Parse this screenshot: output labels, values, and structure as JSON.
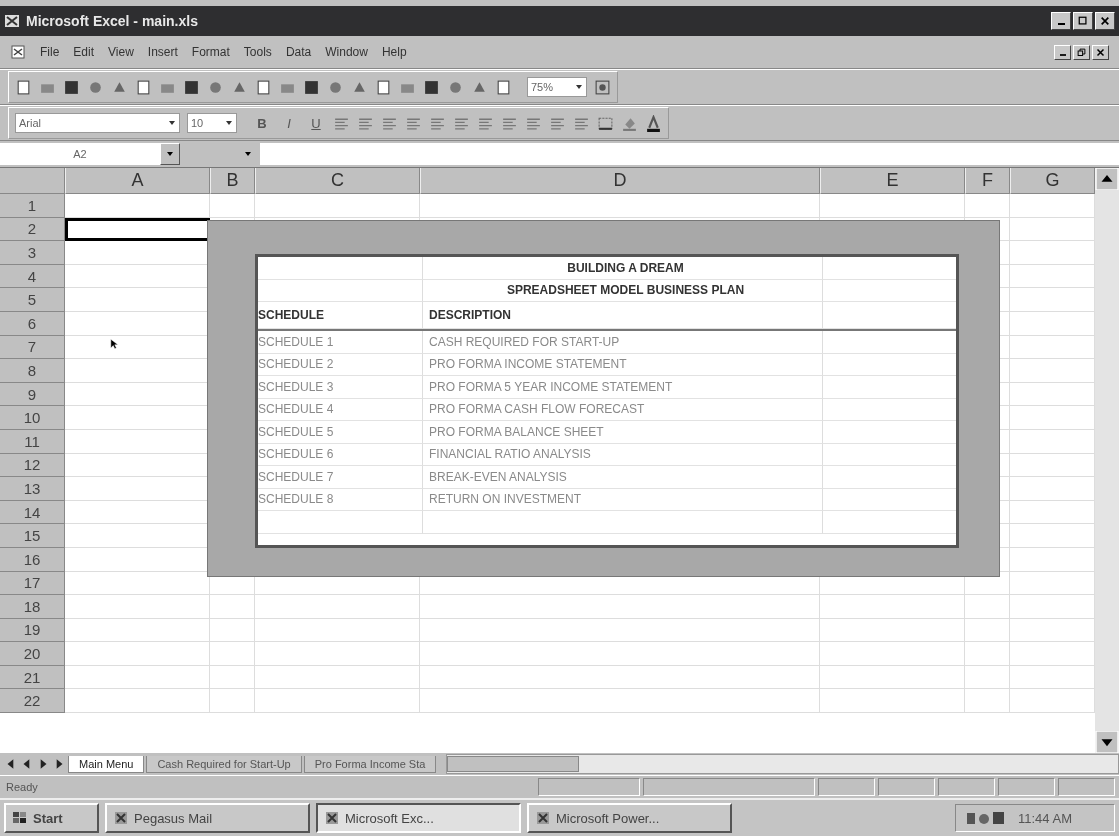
{
  "window": {
    "title": "Microsoft Excel - main.xls"
  },
  "menu": [
    "File",
    "Edit",
    "View",
    "Insert",
    "Format",
    "Tools",
    "Data",
    "Window",
    "Help"
  ],
  "toolbar": {
    "font": "Arial",
    "font_size": "10",
    "zoom": "75%",
    "format_buttons": [
      "B",
      "I",
      "U"
    ]
  },
  "formula_bar": {
    "name_box": "A2"
  },
  "sheet": {
    "columns": [
      "A",
      "B",
      "C",
      "D",
      "E",
      "F",
      "G"
    ],
    "rows": [
      {
        "label": "1",
        "selected": false
      },
      {
        "label": "2",
        "selected": true
      },
      {
        "label": "3",
        "selected": false
      },
      {
        "label": "4",
        "selected": false
      },
      {
        "label": "5",
        "selected": false
      },
      {
        "label": "6",
        "selected": false
      },
      {
        "label": "7",
        "selected": false
      },
      {
        "label": "8",
        "selected": false
      },
      {
        "label": "9",
        "selected": false
      },
      {
        "label": "10",
        "selected": false
      },
      {
        "label": "11",
        "selected": false
      },
      {
        "label": "12",
        "selected": false
      },
      {
        "label": "13",
        "selected": false
      },
      {
        "label": "14",
        "selected": false
      },
      {
        "label": "15",
        "selected": false
      },
      {
        "label": "16",
        "selected": false
      },
      {
        "label": "17",
        "selected": false
      },
      {
        "label": "18",
        "selected": false
      },
      {
        "label": "19",
        "selected": false
      },
      {
        "label": "20",
        "selected": false
      },
      {
        "label": "21",
        "selected": false
      },
      {
        "label": "22",
        "selected": false
      }
    ]
  },
  "embedded": {
    "title": "BUILDING A DREAM",
    "subtitle": "SPREADSHEET MODEL BUSINESS PLAN",
    "headers": [
      "SCHEDULE",
      "DESCRIPTION"
    ],
    "rows": [
      {
        "schedule": "SCHEDULE 1",
        "description": "CASH REQUIRED FOR START-UP"
      },
      {
        "schedule": "SCHEDULE 2",
        "description": "PRO FORMA INCOME STATEMENT"
      },
      {
        "schedule": "SCHEDULE 3",
        "description": "PRO FORMA 5 YEAR INCOME STATEMENT"
      },
      {
        "schedule": "SCHEDULE 4",
        "description": "PRO FORMA CASH FLOW FORECAST"
      },
      {
        "schedule": "SCHEDULE 5",
        "description": "PRO FORMA BALANCE SHEET"
      },
      {
        "schedule": "SCHEDULE 6",
        "description": "FINANCIAL RATIO ANALYSIS"
      },
      {
        "schedule": "SCHEDULE 7",
        "description": "BREAK-EVEN ANALYSIS"
      },
      {
        "schedule": "SCHEDULE 8",
        "description": "RETURN ON INVESTMENT"
      }
    ]
  },
  "sheet_tabs": [
    {
      "label": "Main Menu",
      "selected": true
    },
    {
      "label": "Cash Required for Start-Up",
      "selected": false
    },
    {
      "label": "Pro Forma Income Sta",
      "selected": false
    }
  ],
  "status_bar": {
    "text": "Ready"
  },
  "taskbar": {
    "start": "Start",
    "tasks": [
      {
        "label": "Pegasus Mail",
        "selected": false
      },
      {
        "label": "Microsoft Exc...",
        "selected": true
      },
      {
        "label": "Microsoft Power...",
        "selected": false
      }
    ],
    "clock": "11:44 AM"
  }
}
